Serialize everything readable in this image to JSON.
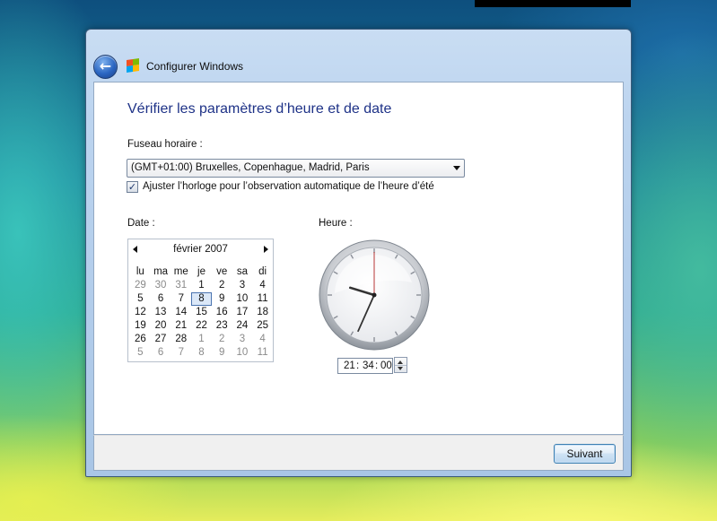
{
  "window": {
    "title": "Configurer Windows"
  },
  "page": {
    "heading": "Vérifier les paramètres d’heure et de date",
    "timezone_label": "Fuseau horaire :",
    "timezone_value": "(GMT+01:00) Bruxelles, Copenhague, Madrid, Paris",
    "dst_label": "Ajuster l’horloge pour l’observation automatique de l’heure d’été",
    "dst_checked": true,
    "date_label": "Date :",
    "time_label": "Heure :"
  },
  "calendar": {
    "month_label": "février 2007",
    "weekdays": [
      "lu",
      "ma",
      "me",
      "je",
      "ve",
      "sa",
      "di"
    ],
    "days": [
      [
        "29",
        "30",
        "31",
        "1",
        "2",
        "3",
        "4"
      ],
      [
        "5",
        "6",
        "7",
        "8",
        "9",
        "10",
        "11"
      ],
      [
        "12",
        "13",
        "14",
        "15",
        "16",
        "17",
        "18"
      ],
      [
        "19",
        "20",
        "21",
        "22",
        "23",
        "24",
        "25"
      ],
      [
        "26",
        "27",
        "28",
        "1",
        "2",
        "3",
        "4"
      ],
      [
        "5",
        "6",
        "7",
        "8",
        "9",
        "10",
        "11"
      ]
    ],
    "selected_day": "8"
  },
  "clock": {
    "time": {
      "hours": "21",
      "minutes": "34",
      "seconds": "00"
    },
    "separator": ":"
  },
  "footer": {
    "next_label": "Suivant"
  }
}
